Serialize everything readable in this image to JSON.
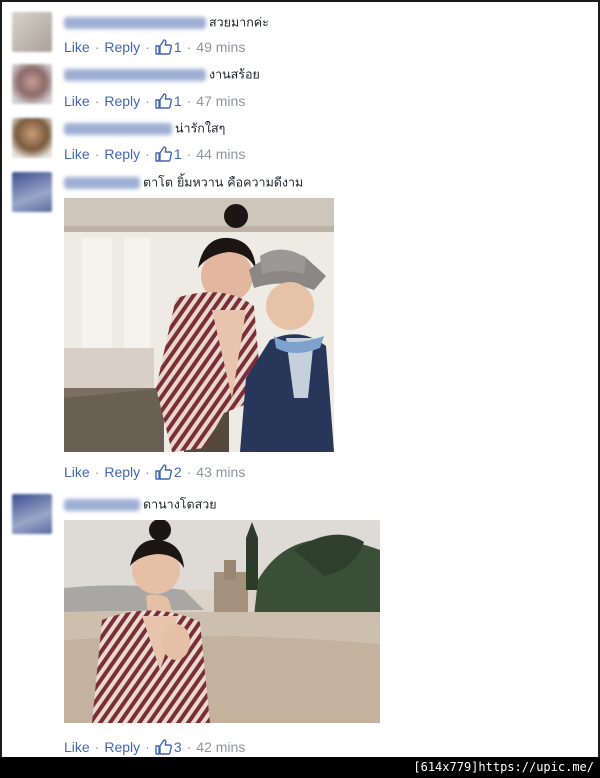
{
  "comments": [
    {
      "text": "สวยมากค่ะ",
      "actions": {
        "like": "Like",
        "reply": "Reply",
        "count": "1",
        "time": "49 mins"
      }
    },
    {
      "text": "งานสร้อย",
      "actions": {
        "like": "Like",
        "reply": "Reply",
        "count": "1",
        "time": "47 mins"
      }
    },
    {
      "text": "น่ารักใสๆ",
      "actions": {
        "like": "Like",
        "reply": "Reply",
        "count": "1",
        "time": "44 mins"
      }
    },
    {
      "text": "ตาโต ยิ้มหวาน คือความดีงาม",
      "actions": {
        "like": "Like",
        "reply": "Reply",
        "count": "2",
        "time": "43 mins"
      }
    },
    {
      "text": "ดานางโตสวย",
      "actions": {
        "like": "Like",
        "reply": "Reply",
        "count": "3",
        "time": "42 mins"
      }
    }
  ],
  "watermark": "[614x779]https://upic.me/",
  "colors": {
    "link": "#4267b2",
    "muted": "#90949c",
    "text": "#1d2129"
  }
}
